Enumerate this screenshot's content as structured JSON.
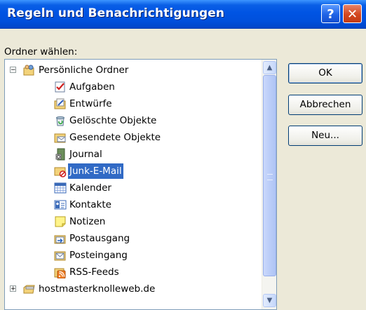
{
  "window": {
    "title": "Regeln und Benachrichtigungen",
    "help_glyph": "?",
    "close_glyph": "✕"
  },
  "folder_label": "Ordner wählen:",
  "buttons": {
    "ok": "OK",
    "cancel": "Abbrechen",
    "new": "Neu..."
  },
  "tree": {
    "items": [
      {
        "label": "Persönliche Ordner",
        "icon": "personal-folders-icon",
        "expander": "−",
        "level": 0
      },
      {
        "label": "Aufgaben",
        "icon": "tasks-icon",
        "level": 1
      },
      {
        "label": "Entwürfe",
        "icon": "drafts-icon",
        "level": 1
      },
      {
        "label": "Gelöschte Objekte",
        "icon": "deleted-items-icon",
        "level": 1
      },
      {
        "label": "Gesendete Objekte",
        "icon": "sent-items-icon",
        "level": 1
      },
      {
        "label": "Journal",
        "icon": "journal-icon",
        "level": 1
      },
      {
        "label": "Junk-E-Mail",
        "icon": "junk-mail-icon",
        "level": 1,
        "selected": true
      },
      {
        "label": "Kalender",
        "icon": "calendar-icon",
        "level": 1
      },
      {
        "label": "Kontakte",
        "icon": "contacts-icon",
        "level": 1
      },
      {
        "label": "Notizen",
        "icon": "notes-icon",
        "level": 1
      },
      {
        "label": "Postausgang",
        "icon": "outbox-icon",
        "level": 1
      },
      {
        "label": "Posteingang",
        "icon": "inbox-icon",
        "level": 1
      },
      {
        "label": "RSS-Feeds",
        "icon": "rss-feeds-icon",
        "level": 1
      },
      {
        "label": "hostmasterknolleweb.de",
        "icon": "mailbox-folder-icon",
        "expander": "+",
        "level": 0
      }
    ],
    "scrollbar": {
      "up_glyph": "▲",
      "down_glyph": "▼"
    }
  },
  "colors": {
    "title_bar": "#0054E3",
    "selection": "#316AC5",
    "dialog_bg": "#ECE9D8"
  }
}
